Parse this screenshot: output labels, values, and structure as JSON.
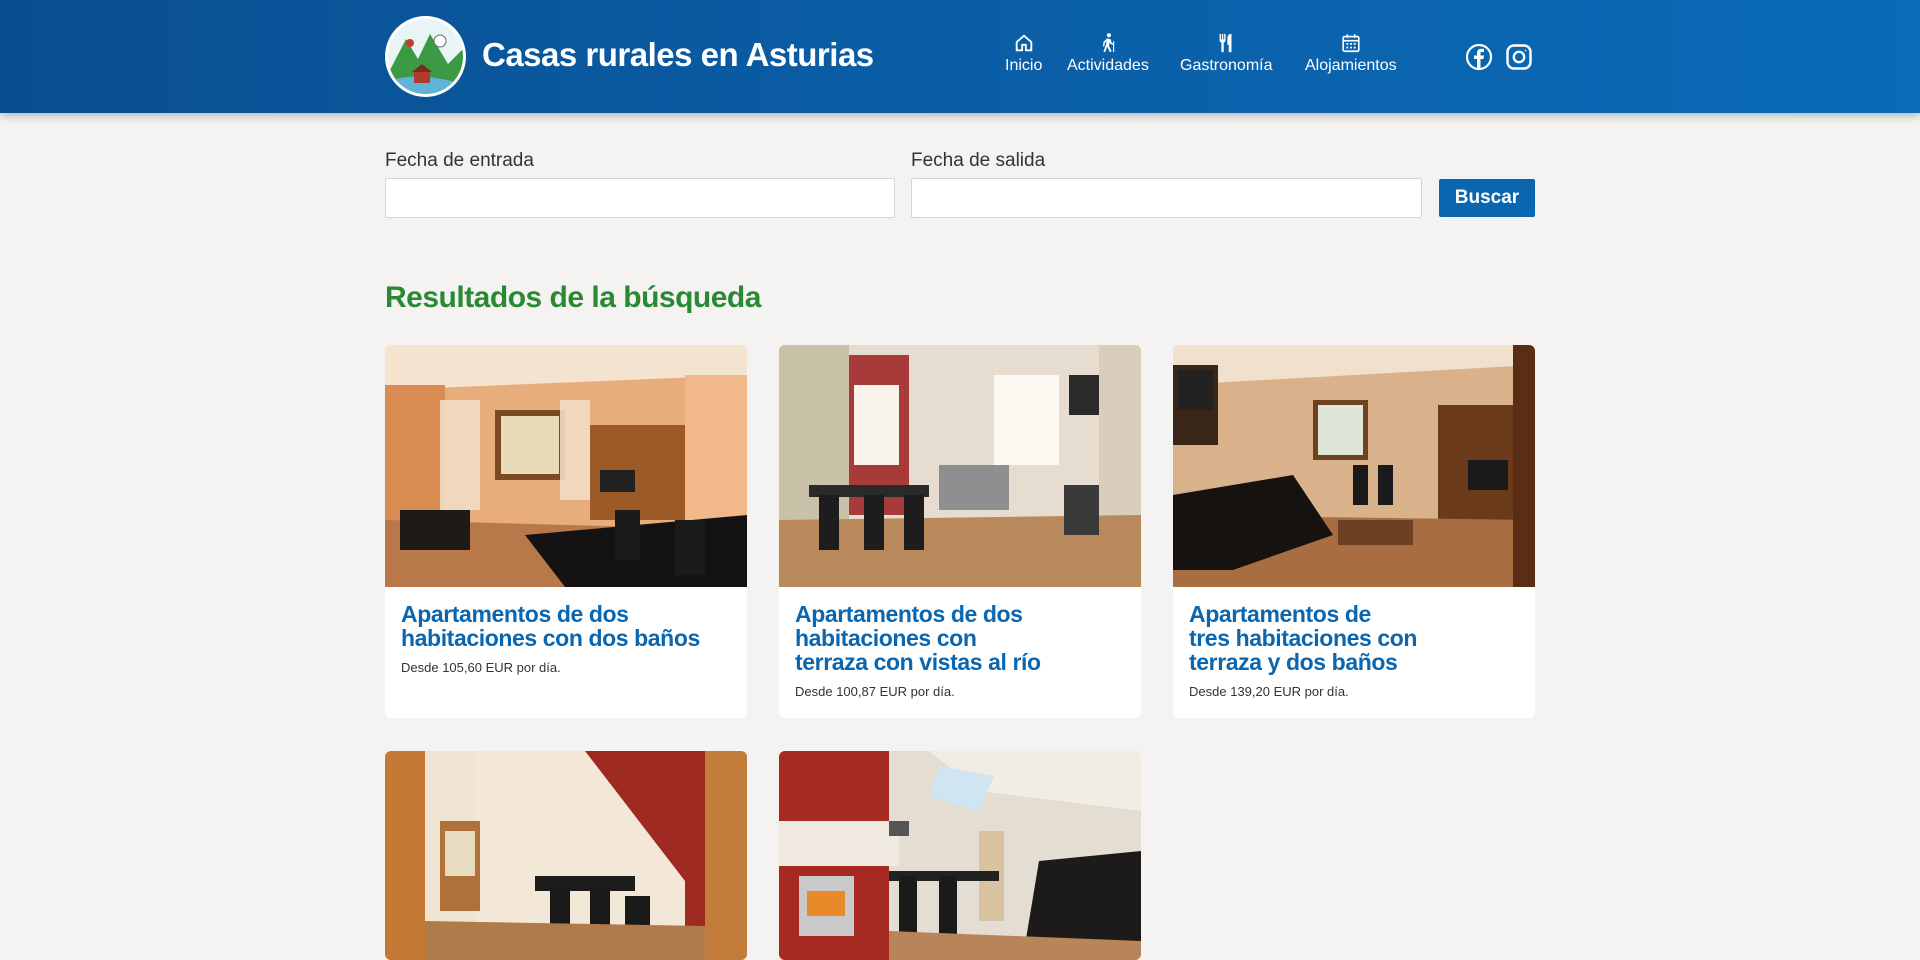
{
  "header": {
    "site_title": "Casas rurales en Asturias",
    "nav": [
      {
        "label": "Inicio",
        "icon": "home-icon"
      },
      {
        "label": "Actividades",
        "icon": "hiking-icon"
      },
      {
        "label": "Gastronomía",
        "icon": "utensils-icon"
      },
      {
        "label": "Alojamientos",
        "icon": "calendar-icon"
      }
    ],
    "social": [
      {
        "icon": "facebook-icon"
      },
      {
        "icon": "instagram-icon"
      }
    ]
  },
  "search": {
    "checkin_label": "Fecha de entrada",
    "checkin_value": "",
    "checkout_label": "Fecha de salida",
    "checkout_value": "",
    "button_label": "Buscar"
  },
  "results": {
    "title": "Resultados de la búsqueda",
    "cards": [
      {
        "title_lines": [
          "Apartamentos de dos",
          "habitaciones con dos baños"
        ],
        "price": "Desde 105,60 EUR por día."
      },
      {
        "title_lines": [
          "Apartamentos de dos",
          "habitaciones con",
          "terraza con vistas al río"
        ],
        "price": "Desde 100,87 EUR por día."
      },
      {
        "title_lines": [
          "Apartamentos de",
          "tres habitaciones con",
          "terraza y dos baños"
        ],
        "price": "Desde 139,20 EUR por día."
      },
      {
        "title_lines": [],
        "price": ""
      },
      {
        "title_lines": [],
        "price": ""
      }
    ]
  },
  "colors": {
    "header_blue": "#0a5ea6",
    "accent_blue": "#0b66b0",
    "results_green": "#2a8a33",
    "background": "#f4f3f2"
  }
}
